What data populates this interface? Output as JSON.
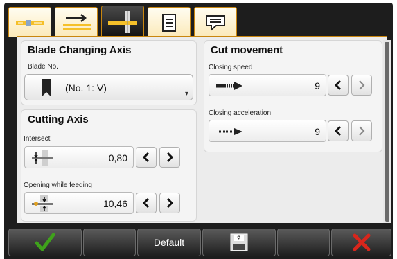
{
  "tabs": [
    {
      "icon": "strip-feed-icon"
    },
    {
      "icon": "arrow-lines-icon"
    },
    {
      "icon": "blade-cut-icon"
    },
    {
      "icon": "document-list-icon"
    },
    {
      "icon": "message-icon"
    }
  ],
  "blade_changing": {
    "title": "Blade Changing Axis",
    "blade_no_label": "Blade No.",
    "blade_no_value": "(No. 1: V)"
  },
  "cutting_axis": {
    "title": "Cutting Axis",
    "intersect_label": "Intersect",
    "intersect_value": "0,80",
    "opening_label": "Opening while feeding",
    "opening_value": "10,46"
  },
  "cut_movement": {
    "title": "Cut movement",
    "closing_speed_label": "Closing speed",
    "closing_speed_value": "9",
    "closing_accel_label": "Closing acceleration",
    "closing_accel_value": "9"
  },
  "bottom": {
    "default_label": "Default"
  },
  "colors": {
    "accent": "#c9860f",
    "confirm": "#3fa21b",
    "cancel": "#d8261c"
  }
}
